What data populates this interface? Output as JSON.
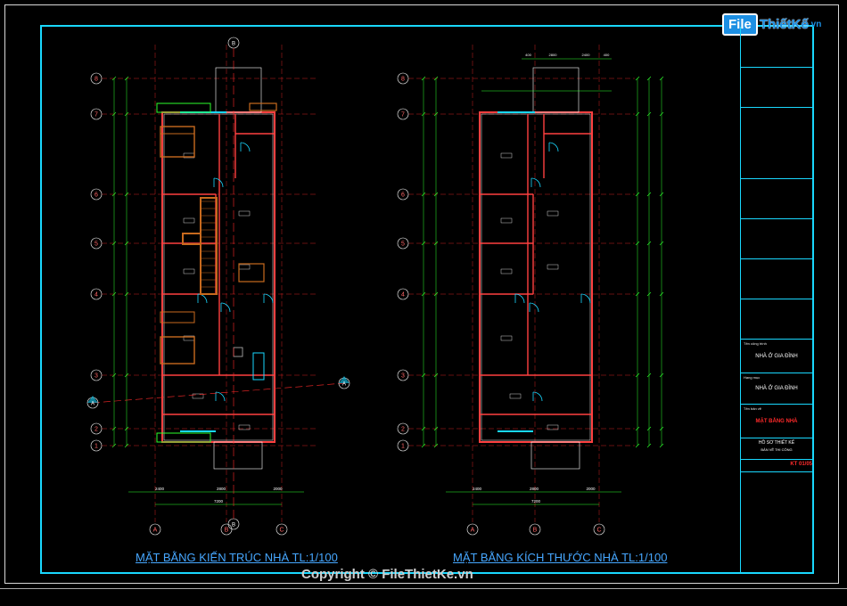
{
  "logo": {
    "box": "File",
    "rest": "ThiếtKế",
    "suffix": ".vn"
  },
  "plans": {
    "left": {
      "caption": "MẶT BẰNG KIẾN TRÚC NHÀ TL:1/100",
      "rows": [
        "8",
        "7",
        "6",
        "5",
        "4",
        "3",
        "2",
        "1"
      ],
      "cols": [
        "A",
        "B",
        "C"
      ],
      "section_marker": "B",
      "overall_dim": "7200",
      "bottom_dims": [
        "2400",
        "2800",
        "2000"
      ]
    },
    "right": {
      "caption": "MẶT BẰNG KÍCH THƯỚC NHÀ TL:1/100",
      "rows": [
        "8",
        "7",
        "6",
        "5",
        "4",
        "3",
        "2",
        "1"
      ],
      "cols": [
        "A",
        "B",
        "C"
      ],
      "overall_dim": "7200",
      "bottom_dims": [
        "2400",
        "2800",
        "2000"
      ],
      "top_dims": [
        "400",
        "2800",
        "2400",
        "400"
      ]
    }
  },
  "title_block": {
    "project_label": "Tên công trình",
    "project_name": "NHÀ Ở GIA ĐÌNH",
    "item_label": "Hạng mục",
    "item_name": "NHÀ Ở GIA ĐÌNH",
    "drawing_label": "Tên bản vẽ",
    "drawing_name": "MẶT BẰNG NHÀ",
    "design_note_1": "HỒ SƠ THIẾT KẾ",
    "design_note_2": "BẢN VẼ THI CÔNG",
    "sheet_code": "KT 01/05"
  },
  "copyright": "Copyright © FileThietKe.vn",
  "colors": {
    "frame": "#19d8ff",
    "axis": "#ff2a2a",
    "dim": "#2cff2c",
    "wall": "#ff4040",
    "caption": "#46a7ff",
    "furniture": "#c86a1e"
  }
}
